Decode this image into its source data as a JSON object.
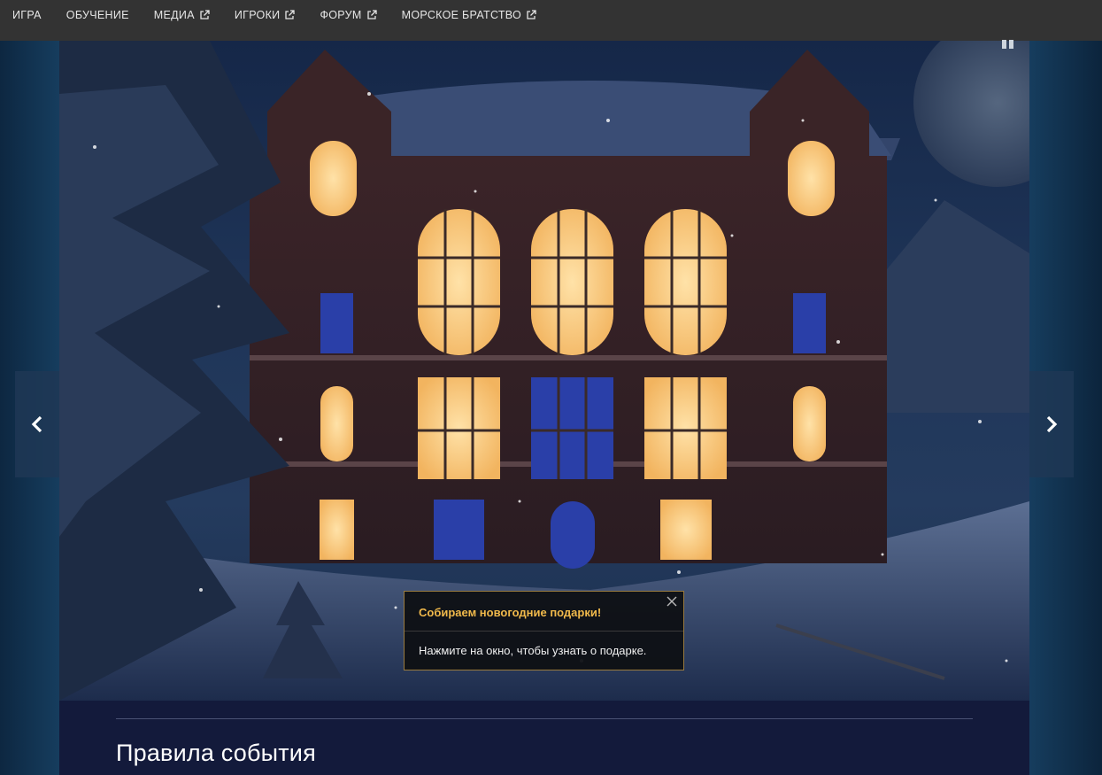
{
  "nav": {
    "items": [
      {
        "label": "ИГРА",
        "external": false
      },
      {
        "label": "ОБУЧЕНИЕ",
        "external": false
      },
      {
        "label": "МЕДИА",
        "external": true
      },
      {
        "label": "ИГРОКИ",
        "external": true
      },
      {
        "label": "ФОРУМ",
        "external": true
      },
      {
        "label": "МОРСКОЕ БРАТСТВО",
        "external": true
      }
    ]
  },
  "banner": {
    "pause_icon": "pause-icon",
    "prev_icon": "chevron-left-icon",
    "next_icon": "chevron-right-icon"
  },
  "tooltip": {
    "title": "Собираем новогодние подарки!",
    "body": "Нажмите на окно, чтобы узнать о подарке.",
    "close_icon": "close-icon"
  },
  "content": {
    "heading": "Правила события"
  },
  "colors": {
    "nav_bg": "#333333",
    "tooltip_title": "#f1b94b",
    "tooltip_border": "#9a7b3f",
    "content_bg": "#131a3b",
    "window_glow": "#f7c77a",
    "window_blue": "#2a3fa8"
  }
}
